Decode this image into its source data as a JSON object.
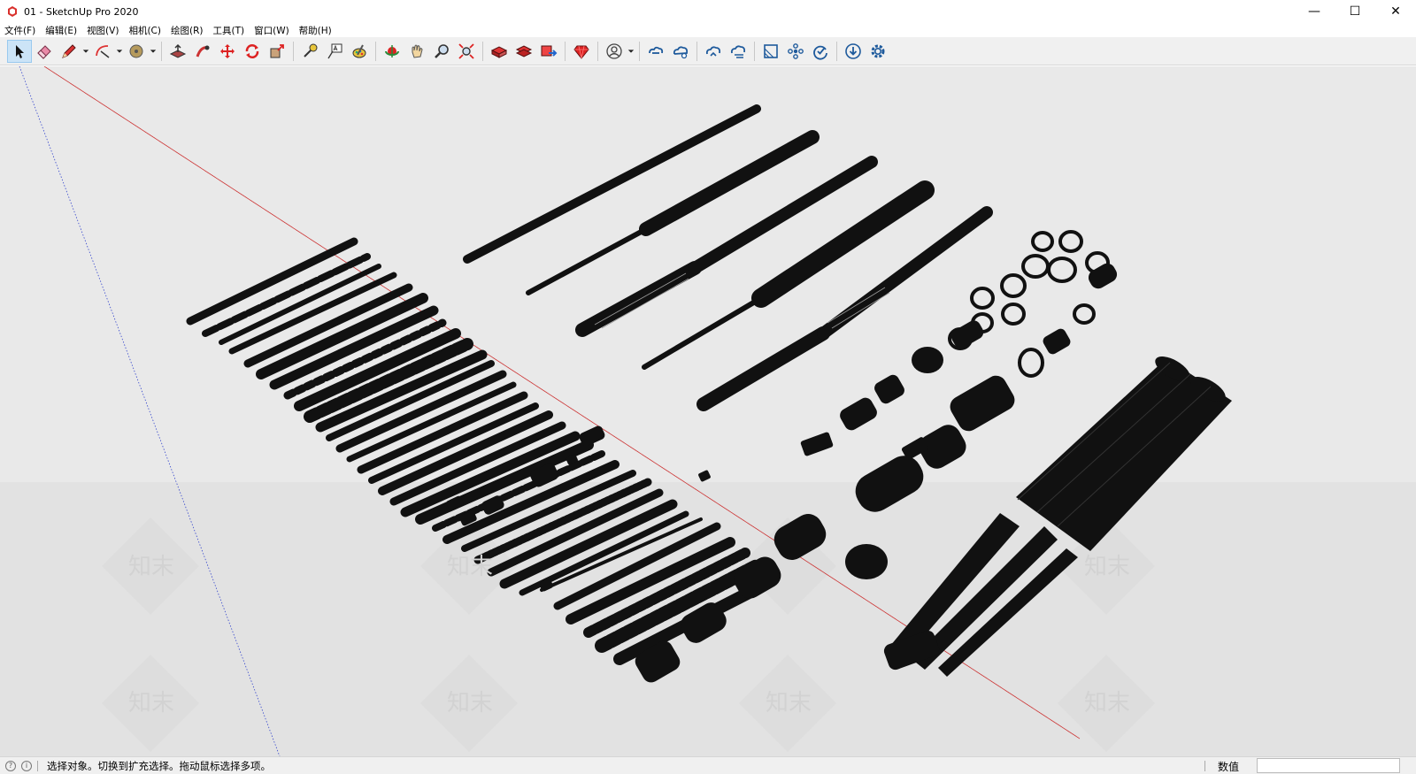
{
  "window": {
    "title": "01 - SketchUp Pro 2020",
    "minimize_glyph": "—",
    "maximize_glyph": "☐",
    "close_glyph": "✕"
  },
  "menu": {
    "items": [
      "文件(F)",
      "编辑(E)",
      "视图(V)",
      "相机(C)",
      "绘图(R)",
      "工具(T)",
      "窗口(W)",
      "帮助(H)"
    ]
  },
  "toolbar": {
    "tools": [
      "select-icon",
      "eraser-icon",
      "pencil-line-icon",
      "arc-icon",
      "paint-bucket-icon",
      "push-pull-icon",
      "follow-me-icon",
      "move-icon",
      "rotate-icon",
      "scale-icon",
      "tape-measure-icon",
      "text-icon",
      "paint-icon",
      "orbit-icon",
      "pan-icon",
      "zoom-icon",
      "zoom-extents-icon",
      "warehouse-icon",
      "extension-warehouse-icon",
      "send-to-layout-icon",
      "ruby-icon",
      "user-account-icon",
      "trimble-connect-icon",
      "cloud-share-icon",
      "cloud-upload-icon",
      "cloud-sync-icon",
      "section-icon",
      "solid-tools-icon",
      "refresh-icon",
      "download-icon",
      "settings-icon"
    ],
    "accent": "#cce4f7"
  },
  "viewport": {
    "background": "#e9e9e9",
    "red_axis_color": "#cc3333",
    "blue_axis_color": "#3344cc",
    "watermark_text": "知末"
  },
  "status": {
    "message": "选择对象。切换到扩充选择。拖动鼠标选择多项。",
    "measure_label": "数值",
    "measure_value": ""
  }
}
